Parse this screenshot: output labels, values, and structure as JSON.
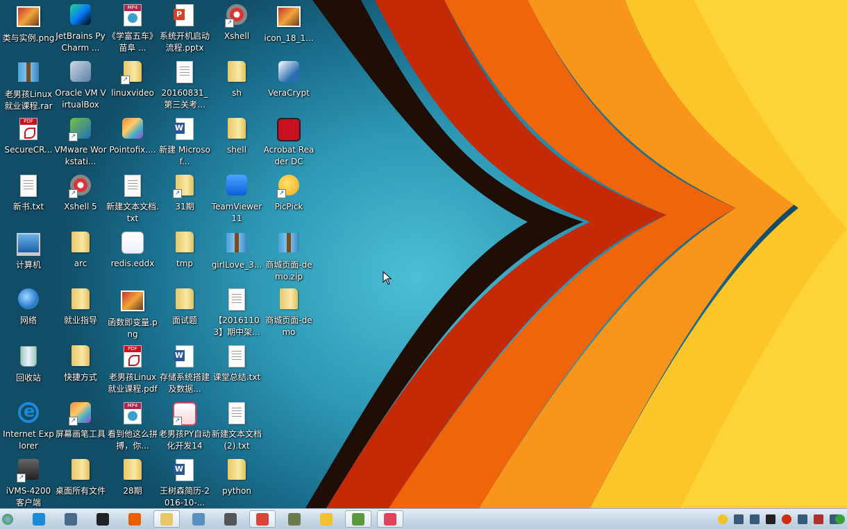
{
  "desktop": {
    "icons": [
      {
        "label": "类与实例.png",
        "type": "img",
        "shortcut": false
      },
      {
        "label": "JetBrains PyCharm ...",
        "type": "app-pycharm",
        "shortcut": false
      },
      {
        "label": "《学富五车》苗阜 ...",
        "type": "mp4",
        "shortcut": false
      },
      {
        "label": "系统开机启动流程.pptx",
        "type": "ppt",
        "shortcut": false
      },
      {
        "label": "Xshell",
        "type": "app-xshell",
        "shortcut": true
      },
      {
        "label": "icon_18_1...",
        "type": "img",
        "shortcut": false
      },
      {
        "label": "老男孩Linux就业课程.rar",
        "type": "zip",
        "shortcut": false
      },
      {
        "label": "Oracle VM VirtualBox",
        "type": "app-vbox",
        "shortcut": false
      },
      {
        "label": "linuxvideo",
        "type": "folder",
        "shortcut": true
      },
      {
        "label": "20160831_第三关考...",
        "type": "doc",
        "shortcut": false
      },
      {
        "label": "sh",
        "type": "folder",
        "shortcut": false
      },
      {
        "label": "VeraCrypt",
        "type": "app-vera",
        "shortcut": false
      },
      {
        "label": "SecureCR...",
        "type": "pdf",
        "shortcut": false
      },
      {
        "label": "VMware Workstati...",
        "type": "app-vmware",
        "shortcut": true
      },
      {
        "label": "Pointofix....",
        "type": "app-pointofix",
        "shortcut": false
      },
      {
        "label": "新建 Microsof...",
        "type": "word",
        "shortcut": false
      },
      {
        "label": "shell",
        "type": "folder",
        "shortcut": false
      },
      {
        "label": "Acrobat Reader DC",
        "type": "app-acrobat",
        "shortcut": false
      },
      {
        "label": "新书.txt",
        "type": "doc",
        "shortcut": false
      },
      {
        "label": "Xshell 5",
        "type": "app-xshell",
        "shortcut": true
      },
      {
        "label": "新建文本文档.txt",
        "type": "doc",
        "shortcut": false
      },
      {
        "label": "31期",
        "type": "folder",
        "shortcut": true
      },
      {
        "label": "TeamViewer 11",
        "type": "app-teamviewer",
        "shortcut": false
      },
      {
        "label": "PicPick",
        "type": "app-picpick",
        "shortcut": true
      },
      {
        "label": "计算机",
        "type": "pc",
        "shortcut": false
      },
      {
        "label": "arc",
        "type": "folder",
        "shortcut": false
      },
      {
        "label": "redis.eddx",
        "type": "app-eddx",
        "shortcut": false
      },
      {
        "label": "tmp",
        "type": "folder",
        "shortcut": false
      },
      {
        "label": "girlLove_3...",
        "type": "zip",
        "shortcut": false
      },
      {
        "label": "商城页面-demo.zip",
        "type": "zip",
        "shortcut": false
      },
      {
        "label": "网络",
        "type": "net",
        "shortcut": false
      },
      {
        "label": "就业指导",
        "type": "folder",
        "shortcut": false
      },
      {
        "label": "函数即变量.png",
        "type": "img",
        "shortcut": false
      },
      {
        "label": "面试题",
        "type": "folder",
        "shortcut": false
      },
      {
        "label": "【20161103】期中架...",
        "type": "doc",
        "shortcut": false
      },
      {
        "label": "商城页面-demo",
        "type": "folder",
        "shortcut": false
      },
      {
        "label": "回收站",
        "type": "bin",
        "shortcut": false
      },
      {
        "label": "快捷方式",
        "type": "folder",
        "shortcut": false
      },
      {
        "label": "老男孩Linux就业课程.pdf",
        "type": "pdf",
        "shortcut": false
      },
      {
        "label": "存储系统搭建及数据...",
        "type": "word",
        "shortcut": false
      },
      {
        "label": "课堂总结.txt",
        "type": "doc",
        "shortcut": false
      },
      {
        "label": "",
        "type": "none",
        "shortcut": false
      },
      {
        "label": "Internet Explorer",
        "type": "ie",
        "shortcut": false
      },
      {
        "label": "屏幕画笔工具",
        "type": "app-pointofix",
        "shortcut": true
      },
      {
        "label": "看到他这么拼搏，你...",
        "type": "mp4",
        "shortcut": false
      },
      {
        "label": "老男孩PY自动化开发14",
        "type": "app-heart",
        "shortcut": true
      },
      {
        "label": "新建文本文档 (2).txt",
        "type": "doc",
        "shortcut": false
      },
      {
        "label": "",
        "type": "none",
        "shortcut": false
      },
      {
        "label": "iVMS-4200 客户端",
        "type": "app-ivms",
        "shortcut": true
      },
      {
        "label": "桌面所有文件",
        "type": "folder",
        "shortcut": false
      },
      {
        "label": "28期",
        "type": "folder",
        "shortcut": false
      },
      {
        "label": "王树森简历-2016-10-...",
        "type": "word",
        "shortcut": false
      },
      {
        "label": "python",
        "type": "folder",
        "shortcut": false
      }
    ]
  },
  "taskbar": {
    "start": "start-orb-icon",
    "apps": [
      {
        "name": "ie-icon",
        "color": "#1b8ad8",
        "active": false
      },
      {
        "name": "network-tool-icon",
        "color": "#4a6a8a",
        "active": false
      },
      {
        "name": "qq-icon",
        "color": "#222222",
        "active": false
      },
      {
        "name": "firefox-icon",
        "color": "#e66000",
        "active": false
      },
      {
        "name": "file-explorer-icon",
        "color": "#e8c767",
        "active": true
      },
      {
        "name": "remote-desktop-icon",
        "color": "#5b8fc0",
        "active": false
      },
      {
        "name": "calculator-icon",
        "color": "#555555",
        "active": false
      },
      {
        "name": "chrome-icon",
        "color": "#db4437",
        "active": true
      },
      {
        "name": "settings-tool-icon",
        "color": "#6a7a4a",
        "active": false
      },
      {
        "name": "picpick-icon",
        "color": "#f2c22b",
        "active": false
      },
      {
        "name": "notepad-icon",
        "color": "#5a9a3a",
        "active": true
      },
      {
        "name": "pocket-icon",
        "color": "#e0425a",
        "active": true
      }
    ],
    "tray": [
      {
        "name": "picpick-tray-icon",
        "color": "#f2c22b"
      },
      {
        "name": "network-tray-icon",
        "color": "#3a5a7a"
      },
      {
        "name": "display-tray-icon",
        "color": "#3a5a7a"
      },
      {
        "name": "qq-tray-icon",
        "color": "#222222"
      },
      {
        "name": "record-tray-icon",
        "color": "#d12b0e"
      },
      {
        "name": "volume-tray-icon",
        "color": "#3a5a7a"
      },
      {
        "name": "flag-tray-icon",
        "color": "#b03030"
      },
      {
        "name": "power-tray-icon",
        "color": "#3a5a7a"
      },
      {
        "name": "add-tray-icon",
        "color": "#3aa13a"
      }
    ]
  }
}
